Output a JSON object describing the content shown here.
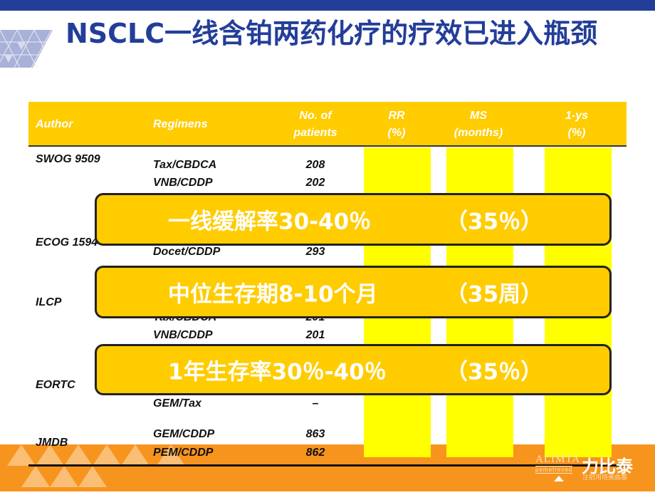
{
  "slide": {
    "title": "NSCLC一线含铂两药化疗的疗效已进入瓶颈"
  },
  "table": {
    "headers": {
      "author": "Author",
      "regimens": "Regimens",
      "patients_line1": "No. of",
      "patients_line2": "patients",
      "rr_line1": "RR",
      "rr_line2": "(%)",
      "ms_line1": "MS",
      "ms_line2": "(months)",
      "ys_line1": "1-ys",
      "ys_line2": "(%)"
    },
    "authors": [
      "SWOG 9509",
      "ECOG 1594",
      "ILCP",
      "EORTC",
      "JMDB"
    ],
    "rows": [
      {
        "regimen": "Tax/CBDCA",
        "patients": "208"
      },
      {
        "regimen": "VNB/CDDP",
        "patients": "202"
      },
      {
        "regimen": "Docet/CDDP",
        "patients": "293"
      },
      {
        "regimen": "Tax/CBDCA",
        "patients": "201"
      },
      {
        "regimen": "VNB/CDDP",
        "patients": "201"
      },
      {
        "regimen": "GEM/Tax",
        "patients": "–"
      },
      {
        "regimen": "GEM/CDDP",
        "patients": "863"
      },
      {
        "regimen": "PEM/CDDP",
        "patients": "862"
      }
    ]
  },
  "callouts": [
    {
      "text": "一线缓解率30-40％",
      "value": "（35％）"
    },
    {
      "text": "中位生存期8-10个月",
      "value": "（35周）"
    },
    {
      "text": "1年生存率30％-40％",
      "value": "（35％）"
    }
  ],
  "brand": {
    "name_en": "ALIMTA",
    "generic": "pemetrexed",
    "name_cn": "力比泰",
    "subtitle": "注射用培美曲塞"
  },
  "colors": {
    "title": "#233e99",
    "header": "#ffcc00",
    "highlight": "#ffff00",
    "footer": "#f7941d"
  }
}
